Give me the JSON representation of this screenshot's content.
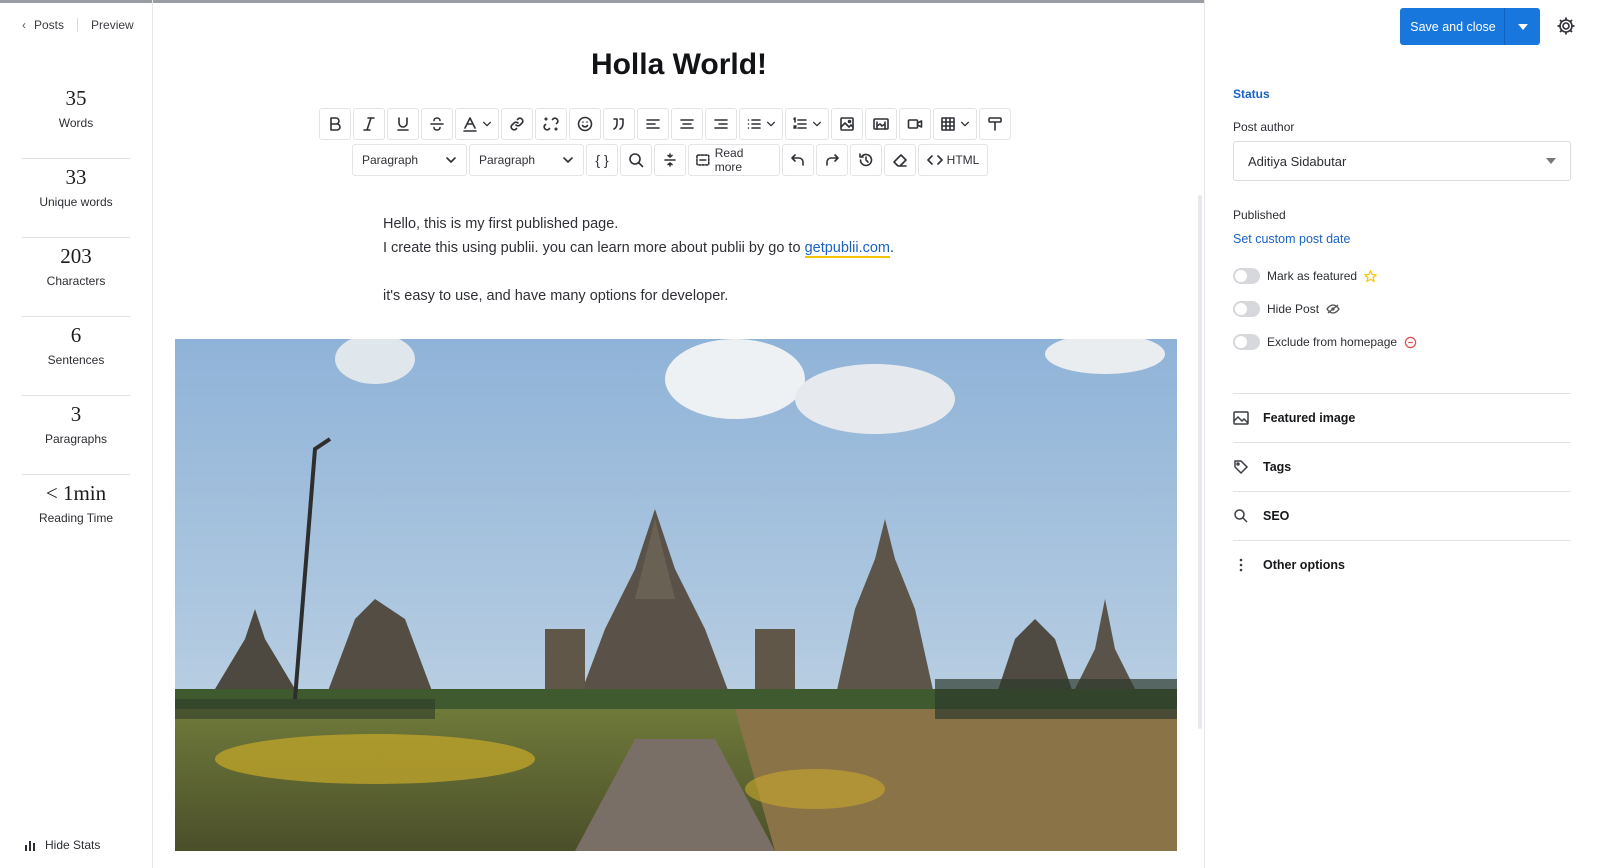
{
  "nav": {
    "back_label": "Posts",
    "preview_label": "Preview"
  },
  "stats": [
    {
      "value": "35",
      "label": "Words"
    },
    {
      "value": "33",
      "label": "Unique words"
    },
    {
      "value": "203",
      "label": "Characters"
    },
    {
      "value": "6",
      "label": "Sentences"
    },
    {
      "value": "3",
      "label": "Paragraphs"
    },
    {
      "value": "< 1min",
      "label": "Reading Time"
    }
  ],
  "hide_stats_label": "Hide Stats",
  "post": {
    "title": "Holla World!",
    "para1_line1": "Hello, this is my first published page.",
    "para1_line2_prefix": "I create this using publii. you can learn more about publii by go to ",
    "para1_link": "getpublii.com",
    "para1_suffix": ".",
    "para2": "it's easy to use, and have many options for developer."
  },
  "toolbar": {
    "format_select_1": "Paragraph",
    "format_select_2": "Paragraph",
    "read_more_label": "Read more",
    "html_label": "HTML"
  },
  "sidebar": {
    "save_label": "Save and close",
    "status_title": "Status",
    "post_author_label": "Post author",
    "post_author_value": "Aditiya Sidabutar",
    "published_label": "Published",
    "custom_date_link": "Set custom post date",
    "toggles": [
      {
        "label": "Mark as featured",
        "on": false
      },
      {
        "label": "Hide Post",
        "on": false
      },
      {
        "label": "Exclude from homepage",
        "on": false
      }
    ],
    "sections": [
      "Featured image",
      "Tags",
      "SEO",
      "Other options"
    ]
  },
  "colors": {
    "accent": "#1877dd",
    "link": "#1a63c7",
    "featured_star": "#f5c300",
    "exclude_icon": "#e24a4a"
  }
}
